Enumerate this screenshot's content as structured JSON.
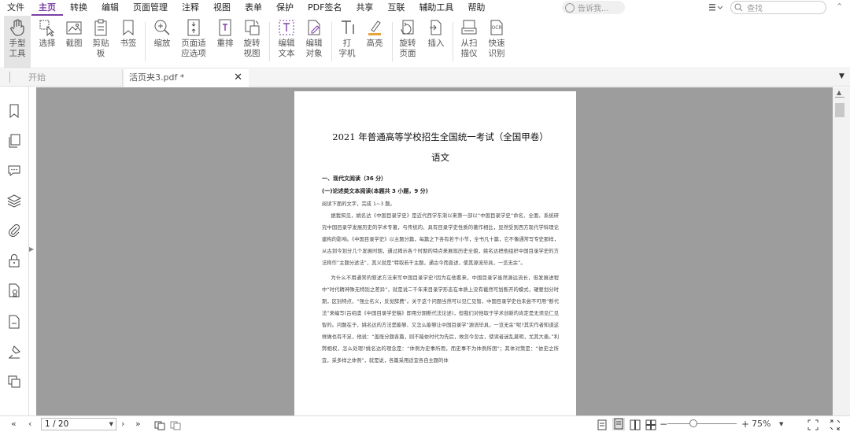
{
  "menu": {
    "items": [
      "文件",
      "主页",
      "转换",
      "编辑",
      "页面管理",
      "注释",
      "视图",
      "表单",
      "保护",
      "PDF签名",
      "共享",
      "互联",
      "辅助工具",
      "帮助"
    ],
    "active": "主页",
    "tell_me_placeholder": "告诉我...",
    "search_placeholder": "查找"
  },
  "ribbon": {
    "hand_tool": "手型\n工具",
    "select": "选择",
    "snapshot": "截图",
    "clipboard": "剪贴\n板",
    "bookmark": "书签",
    "zoom": "缩放",
    "page_fit": "页面适\n应选项",
    "reflow": "重排",
    "rotate_view": "旋转\n视图",
    "edit_text": "编辑\n文本",
    "edit_object": "编辑\n对象",
    "typewriter": "打\n字机",
    "highlight": "高亮",
    "rotate_page": "旋转\n页面",
    "insert": "插入",
    "from_scanner": "从扫\n描仪",
    "quick_ocr": "快速\n识别"
  },
  "tabs": {
    "start": "开始",
    "doc": "活页夹3.pdf *"
  },
  "document": {
    "title": "2021 年普通高等学校招生全国统一考试（全国甲卷）",
    "subject": "语文",
    "section1": "一、现代文阅读（36 分）",
    "section1a": "(一)论述类文本阅读(本题共 3 小题，9 分)",
    "instruction": "阅读下面的文字，完成 1~3 题。",
    "para1": "据我知见，姚名达《中国目录学史》是近代西学东渐以来第一部以“中国目录学史”命名、全面、系统研究中国目录学发展历史的学术专著，与传统的、具有目录学史性质的著作相比，显然受到西方现代学科理论建构的影响。《中国目录学史》以主题分篇，每篇之下各有若干小节，全书凡十篇，它不像通常写专史那样，从古到今划分几个发展时期，通过揭示各个时期的特点来展现历史全貌，姚名达把他组织中国目录学史的方法称作“主题分述法”，其义就是“特取若干主题，通古今而直述，使其源流毕具，一览无余”。",
    "para2": "为什么不用通常的叙述方法来写中国目录学史?因为在他看来，中国目录学虽然源远流长，但发展进程中“时代精神殊无特别之差异”，就是说二千年来目录学形态在本质上没有截然可划断开的模式，硬要划分时期，区别特点，“强立名义，反觉辞费”。关于这个问题当然可以见仁见智，中国目录学史也未尝不可用“断代法”来编写(吕绍虞《中国目录学史稿》即用分期断代法论述)，但我们对他取于学术创新的肯定是无须见仁见智的。问题在于，姚名达的方法是能够、又怎么能够让中国目录学“源流毕具，一览无余”呢?其实作者知道这样做也有不足，他说：“盖既分题各篇，则不能依时代为先后，故忽今忽古，使读者迷乱莫明，尤其大患。”利弊相权，怎么处理?姚名达的理念是：“体例为史事所用，而史事不为体例所困”；其体对策是：“依史之所宜，采多样之体例”，就是说，各篇采用适宜各自主题的体"
  },
  "status": {
    "page": "1 / 20",
    "zoom": "75%",
    "zoom_level": 0.37
  }
}
